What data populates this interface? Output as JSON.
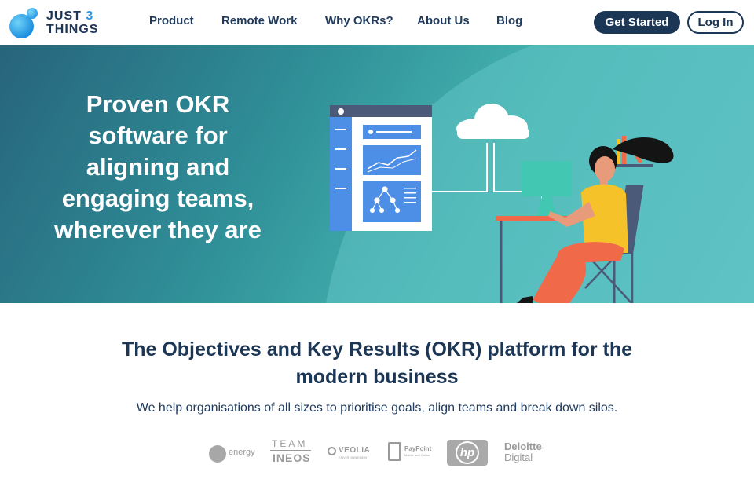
{
  "nav": {
    "logo": {
      "line1": "JUST",
      "number": "3",
      "line2": "THINGS"
    },
    "links": [
      "Product",
      "Remote Work",
      "Why OKRs?",
      "About Us",
      "Blog"
    ],
    "cta_primary": "Get Started",
    "cta_secondary": "Log In"
  },
  "hero": {
    "title_lines": [
      "Proven OKR",
      "software for",
      "aligning and",
      "engaging teams,",
      "wherever they are"
    ]
  },
  "intro": {
    "headline_lines": [
      "The Objectives and Key Results (OKR) platform for the",
      "modern business"
    ],
    "subline": "We help organisations of all sizes to prioritise goals, align teams and break down silos."
  },
  "client_logos": {
    "ovo": "energy",
    "ineos_top": "TEAM",
    "ineos_bottom": "INEOS",
    "veolia": "VEOLIA",
    "veolia_sub": "ENVIRONNEMENT",
    "paypoint": "PayPoint",
    "paypoint_sub": "Mobile and Online",
    "hp": "hp",
    "deloitte_top": "Deloitte",
    "deloitte_bottom": "Digital"
  },
  "colors": {
    "navy": "#1c3656",
    "accent_blue": "#2a95e3",
    "hero_teal": "#46b6b2",
    "shirt_yellow": "#f5c22a",
    "pants_coral": "#f06a4a"
  },
  "icons": [
    "logo-mark",
    "cloud-icon",
    "dashboard-panel",
    "hierarchy-icon",
    "bookshelf",
    "person-illustration",
    "monitor-icon",
    "chair"
  ]
}
